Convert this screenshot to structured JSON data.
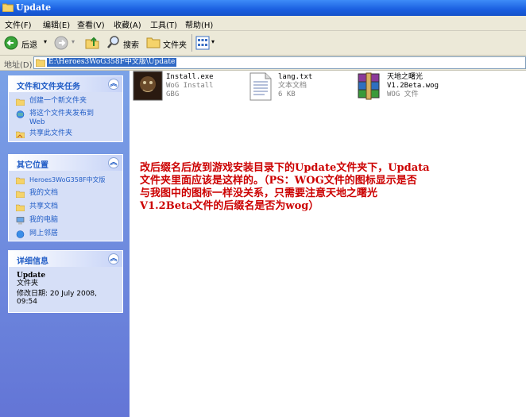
{
  "window": {
    "title": "Update"
  },
  "menu": [
    "文件(F)",
    "编辑(E)",
    "查看(V)",
    "收藏(A)",
    "工具(T)",
    "帮助(H)"
  ],
  "toolbar": {
    "back": "后退",
    "search": "搜索",
    "folders": "文件夹"
  },
  "address": {
    "label": "地址(D)",
    "path": "E:\\Heroes3WoG358F中文版\\Update"
  },
  "tasks": {
    "title": "文件和文件夹任务",
    "items": [
      "创建一个新文件夹",
      "将这个文件夹发布到",
      "Web",
      "共享此文件夹"
    ]
  },
  "places": {
    "title": "其它位置",
    "items": [
      "Heroes3WoG358F中文版",
      "我的文档",
      "共享文档",
      "我的电脑",
      "网上邻居"
    ]
  },
  "details": {
    "title": "详细信息",
    "name": "Update",
    "type": "文件夹",
    "modified": "修改日期: 20 July 2008,",
    "modified2": "09:54"
  },
  "files": [
    {
      "name": "Install.exe",
      "line2": "WoG Install",
      "line3": "GBG"
    },
    {
      "name": "lang.txt",
      "line2": "文本文档",
      "line3": "6 KB"
    },
    {
      "name": "天地之曙光",
      "line2": "V1.2Beta.wog",
      "line3": "WOG 文件"
    }
  ],
  "note": {
    "line1": "改后缀名后放到游戏安装目录下的Update文件夹下，Updata",
    "line2": "文件夹里面应该是这样的。（PS：WOG文件的图标显示是否",
    "line3": "与我图中的图标一样没关系，只需要注意天地之曙光",
    "line4": "V1.2Beta文件的后缀名是否为wog）"
  }
}
